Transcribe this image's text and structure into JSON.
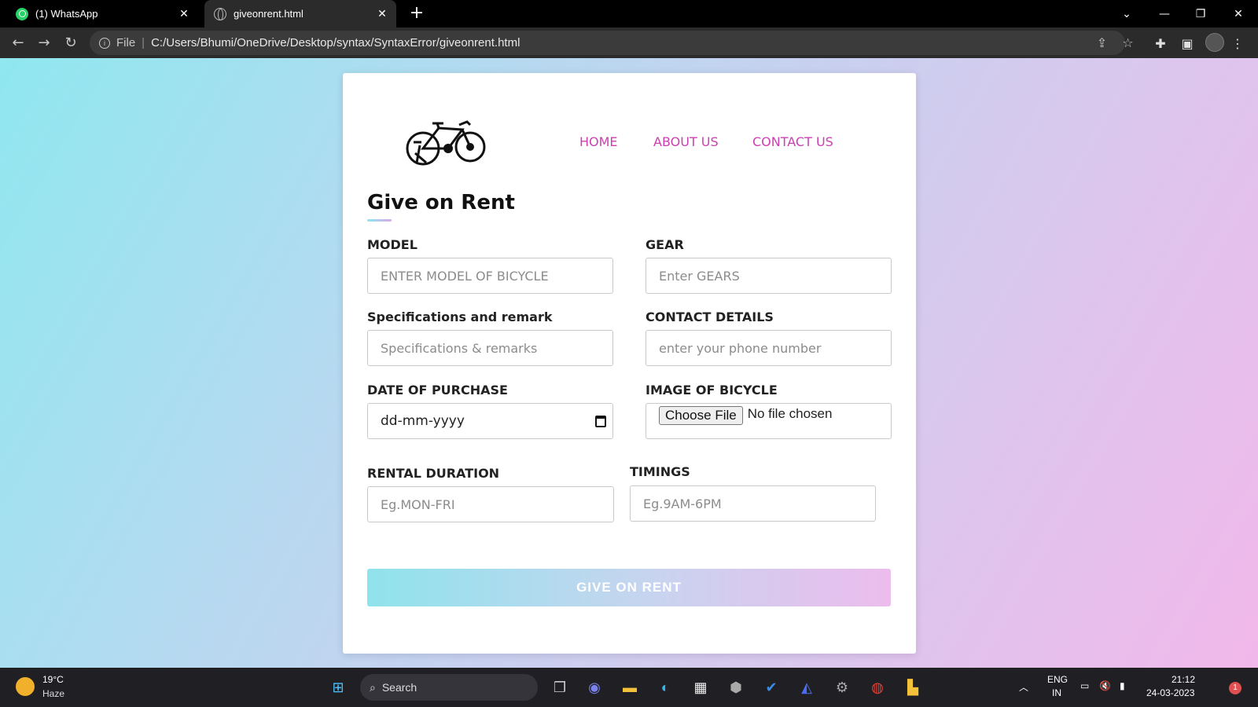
{
  "browser": {
    "tabs": [
      {
        "title": "(1) WhatsApp",
        "active": false,
        "icon": "whatsapp-icon"
      },
      {
        "title": "giveonrent.html",
        "active": true,
        "icon": "globe-icon"
      }
    ],
    "address": {
      "scheme_label": "File",
      "url": "C:/Users/Bhumi/OneDrive/Desktop/syntax/SyntaxError/giveonrent.html"
    }
  },
  "page": {
    "nav": {
      "home": "HOME",
      "about": "ABOUT US",
      "contact": "CONTACT US"
    },
    "title": "Give on Rent",
    "form": {
      "model": {
        "label": "MODEL",
        "placeholder": "ENTER MODEL OF BICYCLE"
      },
      "gear": {
        "label": "GEAR",
        "placeholder": "Enter GEARS"
      },
      "specs": {
        "label": "Specifications and remark",
        "placeholder": "Specifications & remarks"
      },
      "contact": {
        "label": "CONTACT DETAILS",
        "placeholder": "enter your phone number"
      },
      "date": {
        "label": "DATE OF PURCHASE",
        "placeholder": "dd-mm-yyyy"
      },
      "image": {
        "label": "IMAGE OF BICYCLE",
        "button": "Choose File",
        "status": "No file chosen"
      },
      "duration": {
        "label": "RENTAL DURATION",
        "placeholder": "Eg.MON-FRI"
      },
      "timings": {
        "label": "TIMINGS",
        "placeholder": "Eg.9AM-6PM"
      },
      "submit": "GIVE ON RENT"
    },
    "colors": {
      "nav_link": "#cc3fb0",
      "gradient_start": "#8fe7ef",
      "gradient_end": "#f1b8ea"
    }
  },
  "taskbar": {
    "weather": {
      "temp": "19°C",
      "desc": "Haze"
    },
    "search_label": "Search",
    "lang": {
      "line1": "ENG",
      "line2": "IN"
    },
    "clock": {
      "time": "21:12",
      "date": "24-03-2023"
    },
    "notification_count": "1"
  }
}
